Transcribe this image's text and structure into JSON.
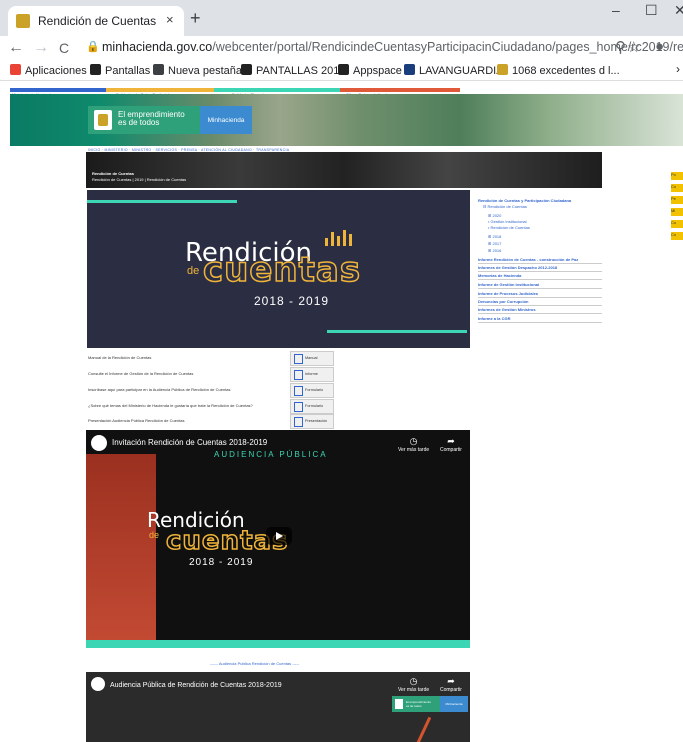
{
  "browser": {
    "tab_title": "Rendición de Cuentas",
    "tab_close": "×",
    "new_tab": "+",
    "minimize": "–",
    "maximize": "☐",
    "close": "✕",
    "back": "←",
    "forward": "→",
    "reload": "C",
    "url_host": "minhacienda.gov.co",
    "url_path": "/webcenter/portal/RendicindeCuentasyParticipacinCiudadano/pages_home/rc2019/re...",
    "zoom_icon": "⚲",
    "star_icon": "☆",
    "account_icon": "●"
  },
  "bookmarks": [
    {
      "label": "Aplicaciones",
      "color": "#ea4335",
      "icon": "apps-grid-icon"
    },
    {
      "label": "Pantallas",
      "color": "#222222",
      "icon": "page-icon"
    },
    {
      "label": "Nueva pestaña",
      "color": "#3c4043",
      "icon": "globe-icon"
    },
    {
      "label": "PANTALLAS 2018",
      "color": "#222222",
      "icon": "page-icon"
    },
    {
      "label": "Appspace",
      "color": "#222222",
      "icon": "page-icon"
    },
    {
      "label": "LAVANGUARDIA",
      "color": "#1a3d7c",
      "icon": "lv-icon"
    },
    {
      "label": "1068 excedentes d l...",
      "color": "#c9a227",
      "icon": "seal-icon"
    }
  ],
  "bookmarks_more": "›",
  "site": {
    "gov_bar": [
      "Ministerio de Hacienda",
      "Entidades de Orden Territorial",
      "Entidades Financieras",
      "Cifras, Datos e Indicadores"
    ],
    "logo_text_line1": "El emprendimiento",
    "logo_text_line2": "es de todos",
    "logo_brand": "Minhacienda",
    "nav": "INICIO · MINISTERIO · MINISTRO · SERVICIOS · PRENSA · ATENCIÓN AL CIUDADANO · TRANSPARENCIA",
    "section_title": "Rendición de Cuentas",
    "section_breadcrumb": "Rendición de Cuentas  |  2019  |  Rendición de Cuentas",
    "banner": {
      "word1": "Rendición",
      "word2": "de",
      "word3": "cuentas",
      "years": "2018 - 2019"
    }
  },
  "sidebar": {
    "items": [
      {
        "label": "Rendición de Cuentas y Participación Ciudadana",
        "level": 0
      },
      {
        "label": "⊟ Rendición de Cuentas",
        "level": 1
      },
      {
        "label": "⊞ 2020",
        "level": 2
      },
      {
        "label": "• Gestión Institucional",
        "level": 2
      },
      {
        "label": "• Rendición de Cuentas",
        "level": 2
      },
      {
        "label": "⊞ 2018",
        "level": 2
      },
      {
        "label": "⊞ 2017",
        "level": 2
      },
      {
        "label": "⊞ 2016",
        "level": 2
      },
      {
        "label": "Informe Rendición de Cuentas - construcción de Paz",
        "level": 0
      },
      {
        "label": "Informes de Gestión Despacho 2012-2018",
        "level": 0
      },
      {
        "label": "Memorias de Hacienda",
        "level": 0
      },
      {
        "label": "Informe de Gestión Institucional",
        "level": 0
      },
      {
        "label": "Informe de Procesos Judiciales",
        "level": 0
      },
      {
        "label": "Denuncias por Corrupción",
        "level": 0
      },
      {
        "label": "Informes de Gestión Ministros",
        "level": 0
      },
      {
        "label": "Informe a la CGR",
        "level": 0
      }
    ]
  },
  "documents": [
    {
      "text": "Manual de la Rendición de Cuentas",
      "button": "Manual"
    },
    {
      "text": "Consulte el Informe de Gestión de la Rendición de Cuentas",
      "button": "Informe"
    },
    {
      "text": "Inscríbase aquí para participar en la Audiencia Pública de Rendición de Cuentas",
      "button": "Formulario"
    },
    {
      "text": "¿Sobre qué temas del Ministerio de Hacienda le gustaría que trate la Rendición de Cuentas?",
      "button": "Formulario"
    },
    {
      "text": "Presentación Audiencia Pública Rendición de Cuentas",
      "button": "Presentación"
    }
  ],
  "video1": {
    "title": "Invitación Rendición de Cuentas 2018-2019",
    "subtitle": "AUDIENCIA PÚBLICA",
    "watch_later": "Ver más tarde",
    "share": "Compartir",
    "word1": "Rendición",
    "word2": "de",
    "word3": "cuentas",
    "years": "2018 - 2019"
  },
  "caption": "------ Audiencia Pública Rendición de Cuentas -----",
  "video2": {
    "title": "Audiencia Pública de Rendición de Cuentas 2018-2019",
    "watch_later": "Ver más tarde",
    "share": "Compartir",
    "mini_logo": "El emprendimiento es de todos",
    "mini_brand": "Minhacienda"
  },
  "right_buttons": [
    "Po",
    "Co",
    "Pe",
    "Mi",
    "Co",
    "Co"
  ]
}
